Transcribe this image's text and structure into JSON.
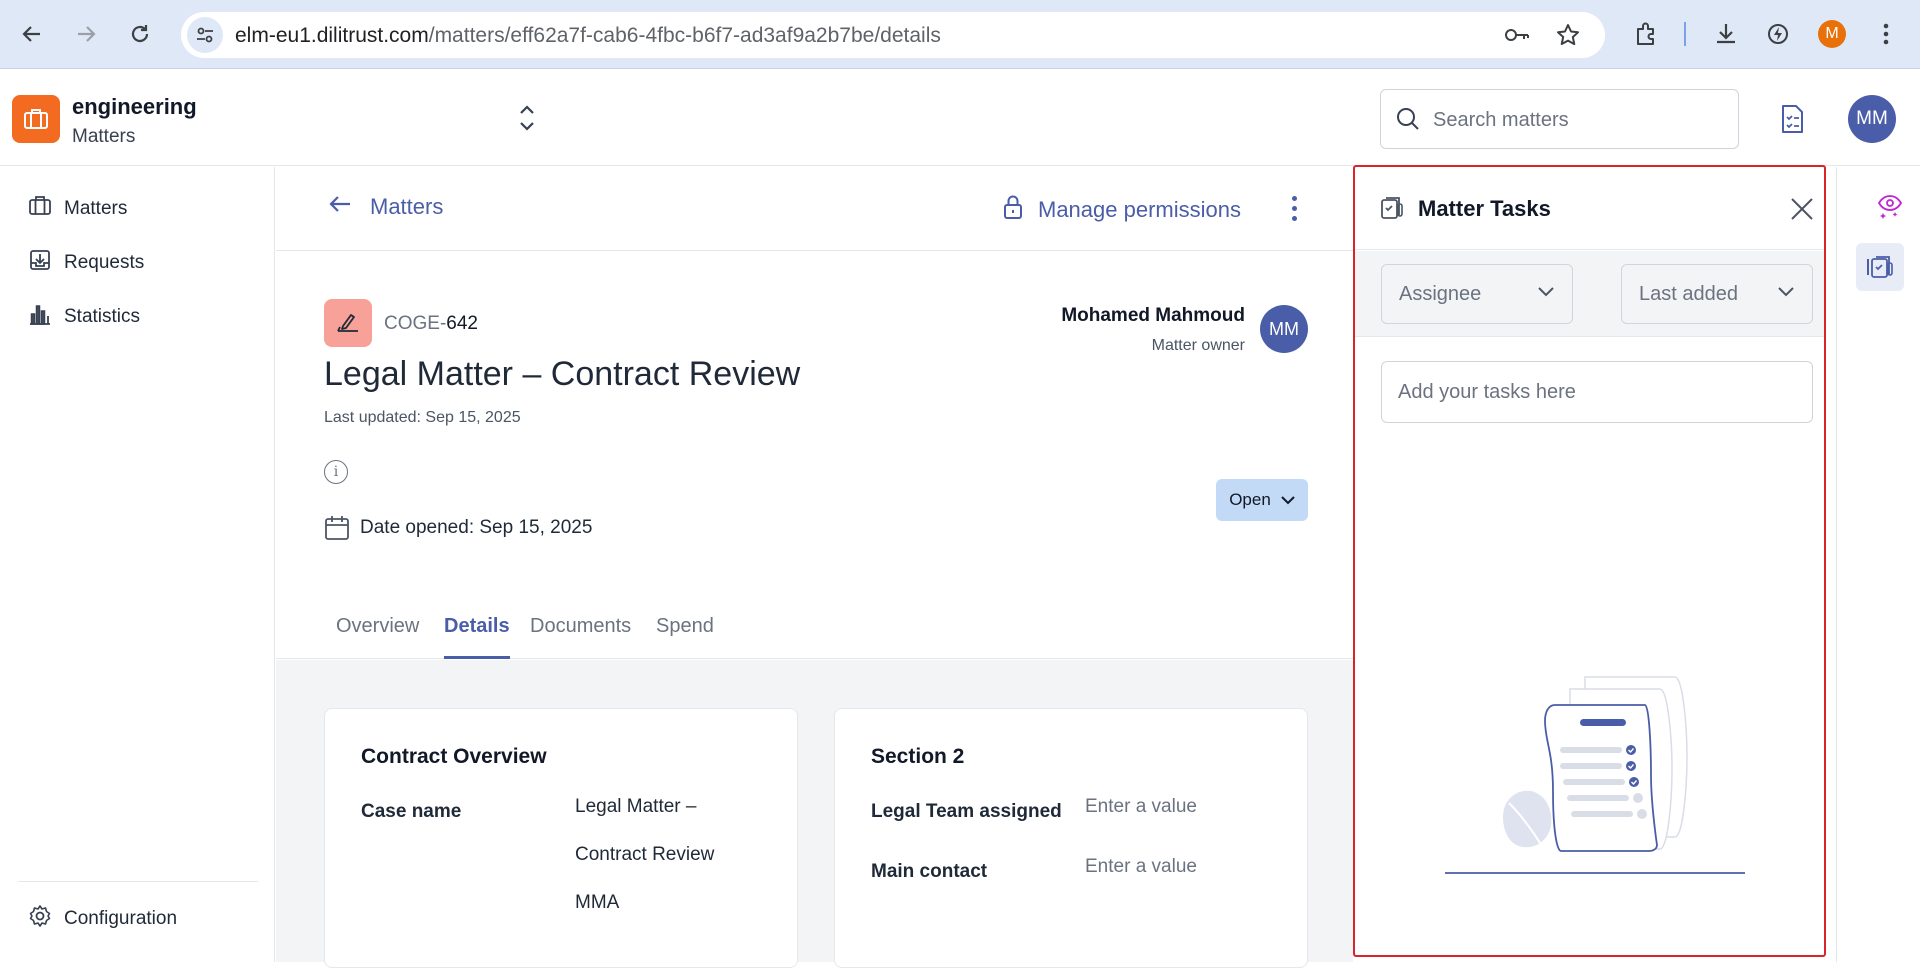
{
  "browser": {
    "url_host": "elm-eu1.dilitrust.com",
    "url_path": "/matters/eff62a7f-cab6-4fbc-b6f7-ad3af9a2b7be/details",
    "profile_initial": "M"
  },
  "header": {
    "workspace_name": "engineering",
    "workspace_section": "Matters",
    "search_placeholder": "Search matters",
    "user_initials": "MM"
  },
  "sidebar": {
    "items": [
      {
        "label": "Matters",
        "icon": "briefcase-icon"
      },
      {
        "label": "Requests",
        "icon": "inbox-download-icon"
      },
      {
        "label": "Statistics",
        "icon": "bar-chart-icon"
      }
    ],
    "footer": {
      "label": "Configuration",
      "icon": "gear-icon"
    }
  },
  "main": {
    "back_label": "Matters",
    "permissions_label": "Manage permissions",
    "ref_prefix": "COGE-",
    "ref_number": "642",
    "title": "Legal Matter – Contract Review",
    "last_updated": "Last updated: Sep 15, 2025",
    "date_opened": "Date opened: Sep 15, 2025",
    "owner": {
      "name": "Mohamed Mahmoud",
      "role": "Matter owner",
      "initials": "MM"
    },
    "status": "Open",
    "tabs": [
      "Overview",
      "Details",
      "Documents",
      "Spend"
    ],
    "active_tab": "Details",
    "cards": [
      {
        "title": "Contract Overview",
        "fields": [
          {
            "label": "Case name",
            "value_lines": [
              "Legal Matter –",
              "Contract Review",
              "MMA"
            ]
          }
        ]
      },
      {
        "title": "Section 2",
        "fields": [
          {
            "label": "Legal Team assigned",
            "value": "Enter a value"
          },
          {
            "label": "Main contact",
            "value": "Enter a value"
          }
        ]
      }
    ]
  },
  "tasks_panel": {
    "title": "Matter Tasks",
    "filters": {
      "assignee": "Assignee",
      "sort": "Last added"
    },
    "input_placeholder": "Add your tasks here"
  },
  "colors": {
    "accent": "#4a5da8",
    "brand": "#f36b21",
    "status_bg": "#c3daf6",
    "highlight_border": "#d9252a"
  }
}
